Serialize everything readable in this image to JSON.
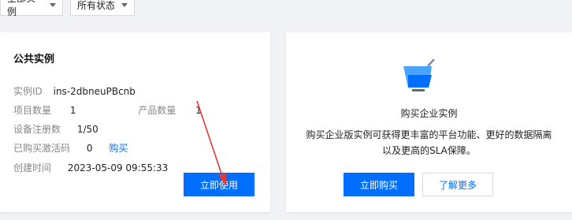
{
  "filters": {
    "instance_scope": "全部实例",
    "status": "所有状态"
  },
  "public_card": {
    "title": "公共实例",
    "instance_id_label": "实例ID",
    "instance_id_value": "ins-2dbneuPBcnb",
    "project_count_label": "项目数量",
    "project_count_value": "1",
    "product_count_label": "产品数量",
    "product_count_value": "1",
    "device_reg_label": "设备注册数",
    "device_reg_value": "1/50",
    "activation_label": "已购买激活码",
    "activation_value": "0",
    "buy_link": "购买",
    "created_label": "创建时间",
    "created_value": "2023-05-09 09:55:33",
    "use_button": "立即使用"
  },
  "enterprise_card": {
    "icon": "shopping-cart-icon",
    "title": "购买企业实例",
    "description": "购买企业版实例可获得更丰富的平台功能、更好的数据隔离以及更高的SLA保障。",
    "buy_button": "立即购买",
    "learn_more_button": "了解更多"
  },
  "colors": {
    "primary": "#006eff",
    "annotation_arrow": "#e53935"
  }
}
